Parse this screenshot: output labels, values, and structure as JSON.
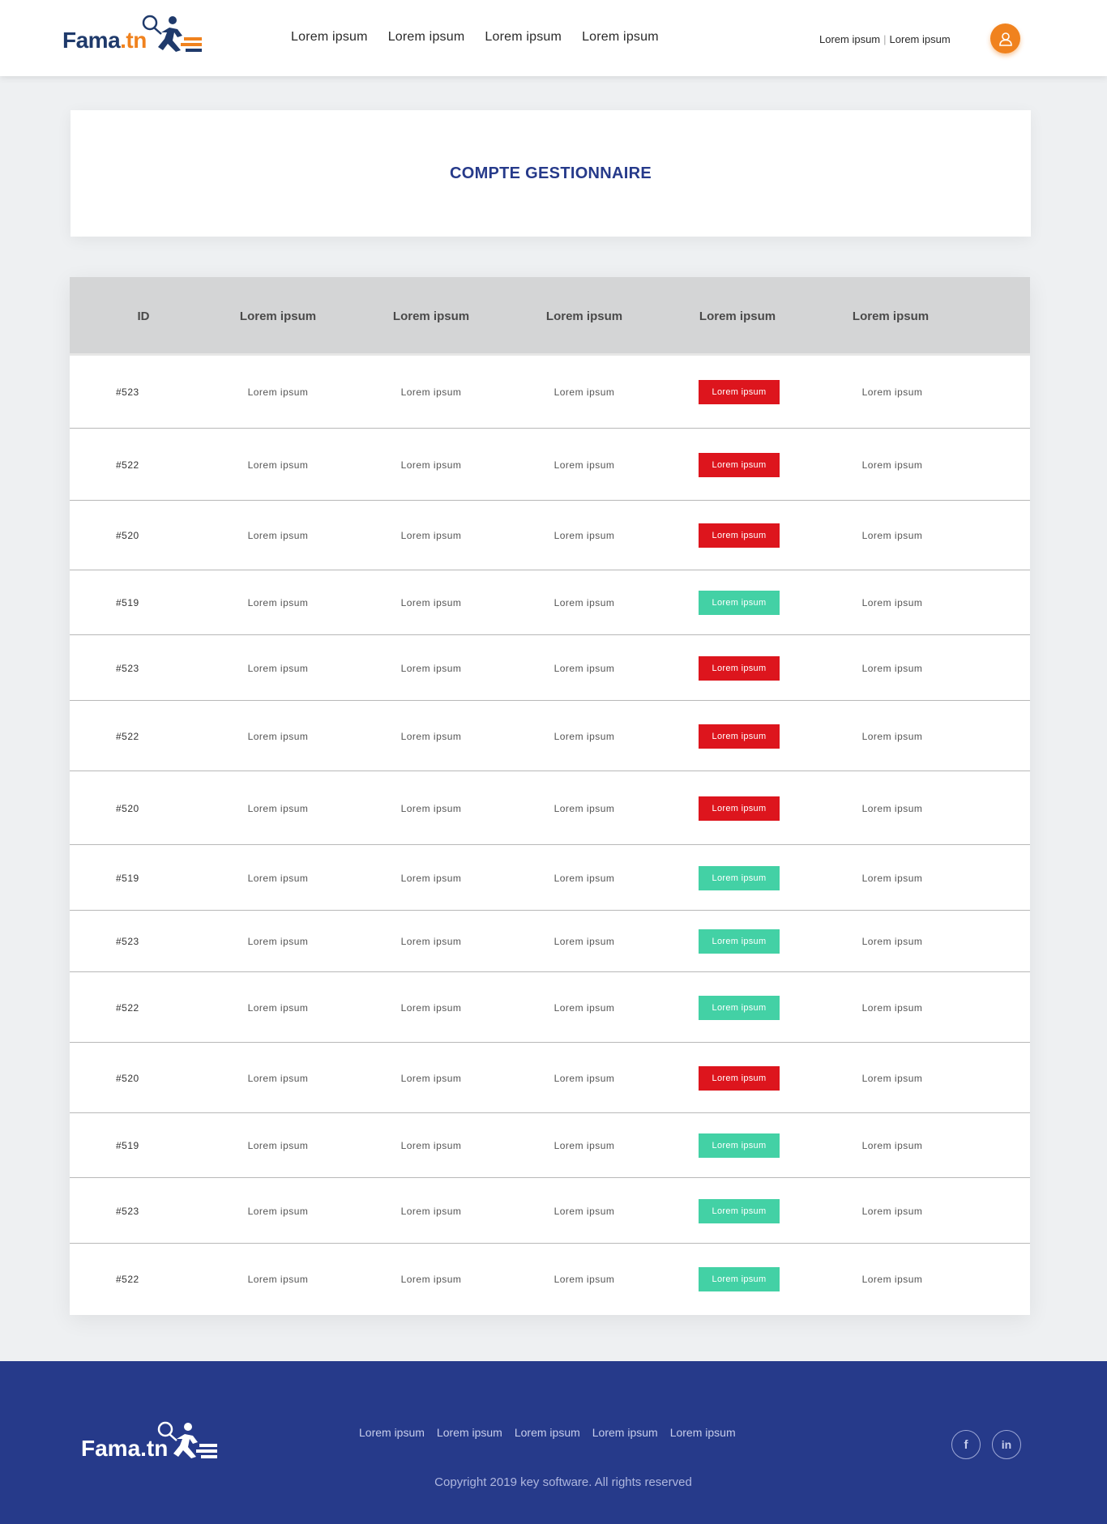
{
  "header": {
    "logo": {
      "brand": "Fama",
      "tld": ".tn"
    },
    "nav": [
      "Lorem ipsum",
      "Lorem ipsum",
      "Lorem ipsum",
      "Lorem ipsum"
    ],
    "top_links": [
      "Lorem ipsum",
      "Lorem ipsum"
    ],
    "avatar_icon": "user-icon"
  },
  "title": "COMPTE GESTIONNAIRE",
  "table": {
    "headers": [
      "ID",
      "Lorem ipsum",
      "Lorem ipsum",
      "Lorem ipsum",
      "Lorem ipsum",
      "Lorem ipsum"
    ],
    "rows": [
      {
        "id": "#523",
        "c1": "Lorem ipsum",
        "c2": "Lorem ipsum",
        "c3": "Lorem ipsum",
        "status": "Lorem ipsum",
        "status_color": "#dd151d",
        "c5": "Lorem ipsum"
      },
      {
        "id": "#522",
        "c1": "Lorem ipsum",
        "c2": "Lorem ipsum",
        "c3": "Lorem ipsum",
        "status": "Lorem ipsum",
        "status_color": "#dd151d",
        "c5": "Lorem ipsum"
      },
      {
        "id": "#520",
        "c1": "Lorem ipsum",
        "c2": "Lorem ipsum",
        "c3": "Lorem ipsum",
        "status": "Lorem ipsum",
        "status_color": "#dd151d",
        "c5": "Lorem ipsum"
      },
      {
        "id": "#519",
        "c1": "Lorem ipsum",
        "c2": "Lorem ipsum",
        "c3": "Lorem ipsum",
        "status": "Lorem ipsum",
        "status_color": "#43d1a5",
        "c5": "Lorem ipsum"
      },
      {
        "id": "#523",
        "c1": "Lorem ipsum",
        "c2": "Lorem ipsum",
        "c3": "Lorem ipsum",
        "status": "Lorem ipsum",
        "status_color": "#dd151d",
        "c5": "Lorem ipsum"
      },
      {
        "id": "#522",
        "c1": "Lorem ipsum",
        "c2": "Lorem ipsum",
        "c3": "Lorem ipsum",
        "status": "Lorem ipsum",
        "status_color": "#dd151d",
        "c5": "Lorem ipsum"
      },
      {
        "id": "#520",
        "c1": "Lorem ipsum",
        "c2": "Lorem ipsum",
        "c3": "Lorem ipsum",
        "status": "Lorem ipsum",
        "status_color": "#dd151d",
        "c5": "Lorem ipsum"
      },
      {
        "id": "#519",
        "c1": "Lorem ipsum",
        "c2": "Lorem ipsum",
        "c3": "Lorem ipsum",
        "status": "Lorem ipsum",
        "status_color": "#43d1a5",
        "c5": "Lorem ipsum"
      },
      {
        "id": "#523",
        "c1": "Lorem ipsum",
        "c2": "Lorem ipsum",
        "c3": "Lorem ipsum",
        "status": "Lorem ipsum",
        "status_color": "#43d1a5",
        "c5": "Lorem ipsum"
      },
      {
        "id": "#522",
        "c1": "Lorem ipsum",
        "c2": "Lorem ipsum",
        "c3": "Lorem ipsum",
        "status": "Lorem ipsum",
        "status_color": "#43d1a5",
        "c5": "Lorem ipsum"
      },
      {
        "id": "#520",
        "c1": "Lorem ipsum",
        "c2": "Lorem ipsum",
        "c3": "Lorem ipsum",
        "status": "Lorem ipsum",
        "status_color": "#dd151d",
        "c5": "Lorem ipsum"
      },
      {
        "id": "#519",
        "c1": "Lorem ipsum",
        "c2": "Lorem ipsum",
        "c3": "Lorem ipsum",
        "status": "Lorem ipsum",
        "status_color": "#43d1a5",
        "c5": "Lorem ipsum"
      },
      {
        "id": "#523",
        "c1": "Lorem ipsum",
        "c2": "Lorem ipsum",
        "c3": "Lorem ipsum",
        "status": "Lorem ipsum",
        "status_color": "#43d1a5",
        "c5": "Lorem ipsum"
      },
      {
        "id": "#522",
        "c1": "Lorem ipsum",
        "c2": "Lorem ipsum",
        "c3": "Lorem ipsum",
        "status": "Lorem ipsum",
        "status_color": "#43d1a5",
        "c5": "Lorem ipsum"
      }
    ]
  },
  "footer": {
    "logo": {
      "brand": "Fama.tn"
    },
    "links": [
      "Lorem ipsum",
      "Lorem ipsum",
      "Lorem ipsum",
      "Lorem ipsum",
      "Lorem ipsum"
    ],
    "copyright": "Copyright 2019 key software. All rights reserved",
    "social": [
      {
        "icon": "facebook-icon",
        "glyph": "f"
      },
      {
        "icon": "linkedin-icon",
        "glyph": "in"
      }
    ]
  },
  "colors": {
    "brand_navy": "#1f3a6b",
    "accent_orange": "#f0821e",
    "title_blue": "#263a8a",
    "status_red": "#dd151d",
    "status_green": "#43d1a5",
    "footer_bg": "#263a8a"
  }
}
